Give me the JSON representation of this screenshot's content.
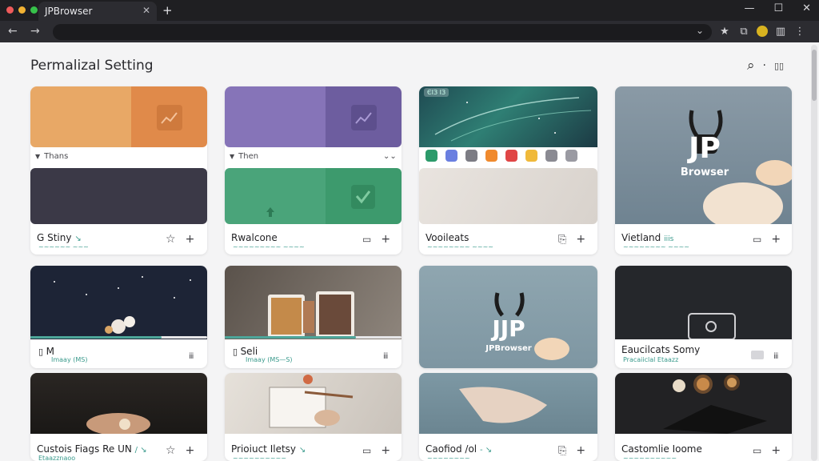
{
  "browser": {
    "tab_title": "JPBrowser",
    "tab_close": "✕",
    "new_tab": "+",
    "window_controls": [
      "—",
      "☐",
      "✕"
    ],
    "nav": {
      "back": "←",
      "forward": "→"
    },
    "omnibox_chevron": "⌄",
    "toolbar_icons": [
      "star-icon",
      "extensions-icon",
      "profile-extension-icon",
      "sidebar-icon",
      "menu-icon"
    ],
    "toolbar_glyphs": {
      "star": "★",
      "extensions": "⧉",
      "sidebar": "▥",
      "menu": "⋮"
    },
    "traffic_light_colors": [
      "#ef5b5b",
      "#f2b233",
      "#37c24a"
    ]
  },
  "page": {
    "title": "Permalizal Setting",
    "search_glyph": "⌕",
    "separator": "·",
    "book_glyph": "▯▯"
  },
  "cards": {
    "c1": {
      "top_label": "Thans",
      "label_icon": "▼",
      "caption": "G Stiny",
      "caption_mark": "↘",
      "subtitle": "~~~~~~ ~~~",
      "colors": [
        "#e8a866",
        "#e08a4a"
      ]
    },
    "c2": {
      "top_label": "Then",
      "label_icon": "▼",
      "top_right": "⌄⌄",
      "caption": "Rwalcone",
      "subtitle": "~~~~~~~~~ ~~~~",
      "colors": [
        "#8674b8",
        "#6d5d9f"
      ]
    },
    "c3": {
      "banner_text": "ЄІЗ  ІЗ",
      "caption": "Vooileats",
      "subtitle": "~~~~~~~~ ~~~~",
      "icon_row_colors": [
        "#2c9a6a",
        "#6a7fe0",
        "#7c7c84",
        "#f08a2e",
        "#e04646",
        "#f0b93a",
        "#8a8a92",
        "#9a9aa2"
      ]
    },
    "c4": {
      "logo": "JP",
      "logo_sub": "Browser",
      "caption": "Vietland",
      "caption_mark": "iiis",
      "subtitle": "~~~~~~~~ ~~~~"
    },
    "r2c1": {
      "caption": "M",
      "subtitle": "Imaay (MS)",
      "meta": "ⅲ",
      "progress": 0.74
    },
    "r2c2": {
      "caption": "Seli",
      "subtitle": "Imaay (MS—S)",
      "meta": "ⅲ",
      "progress": 0.74
    },
    "r2c3": {
      "logo": "JJP",
      "logo_sub": "JPBrowser"
    },
    "r2c4": {
      "caption": "Eaucilcats Somy",
      "subtitle": "Pracaiiclal Etaazz",
      "meta": "ⅲ"
    },
    "r3c1": {
      "caption": "Custois Fiags Re UN",
      "caption_mark": "/ ↘",
      "subtitle": "Etaazznaoo"
    },
    "r3c2": {
      "caption": "Prioiuct Iletsy",
      "caption_mark": "↘",
      "subtitle": "~~~~~~~~~~"
    },
    "r3c3": {
      "caption": "Caofiod /ol",
      "caption_mark": "- ↘",
      "subtitle": "~~~~~~~~"
    },
    "r3c4": {
      "caption": "Castomlie Ioome",
      "subtitle": "~~~~~~~~~~"
    }
  },
  "actions": {
    "star": "☆",
    "plus": "+",
    "comment": "▭",
    "clip": "⎘"
  }
}
